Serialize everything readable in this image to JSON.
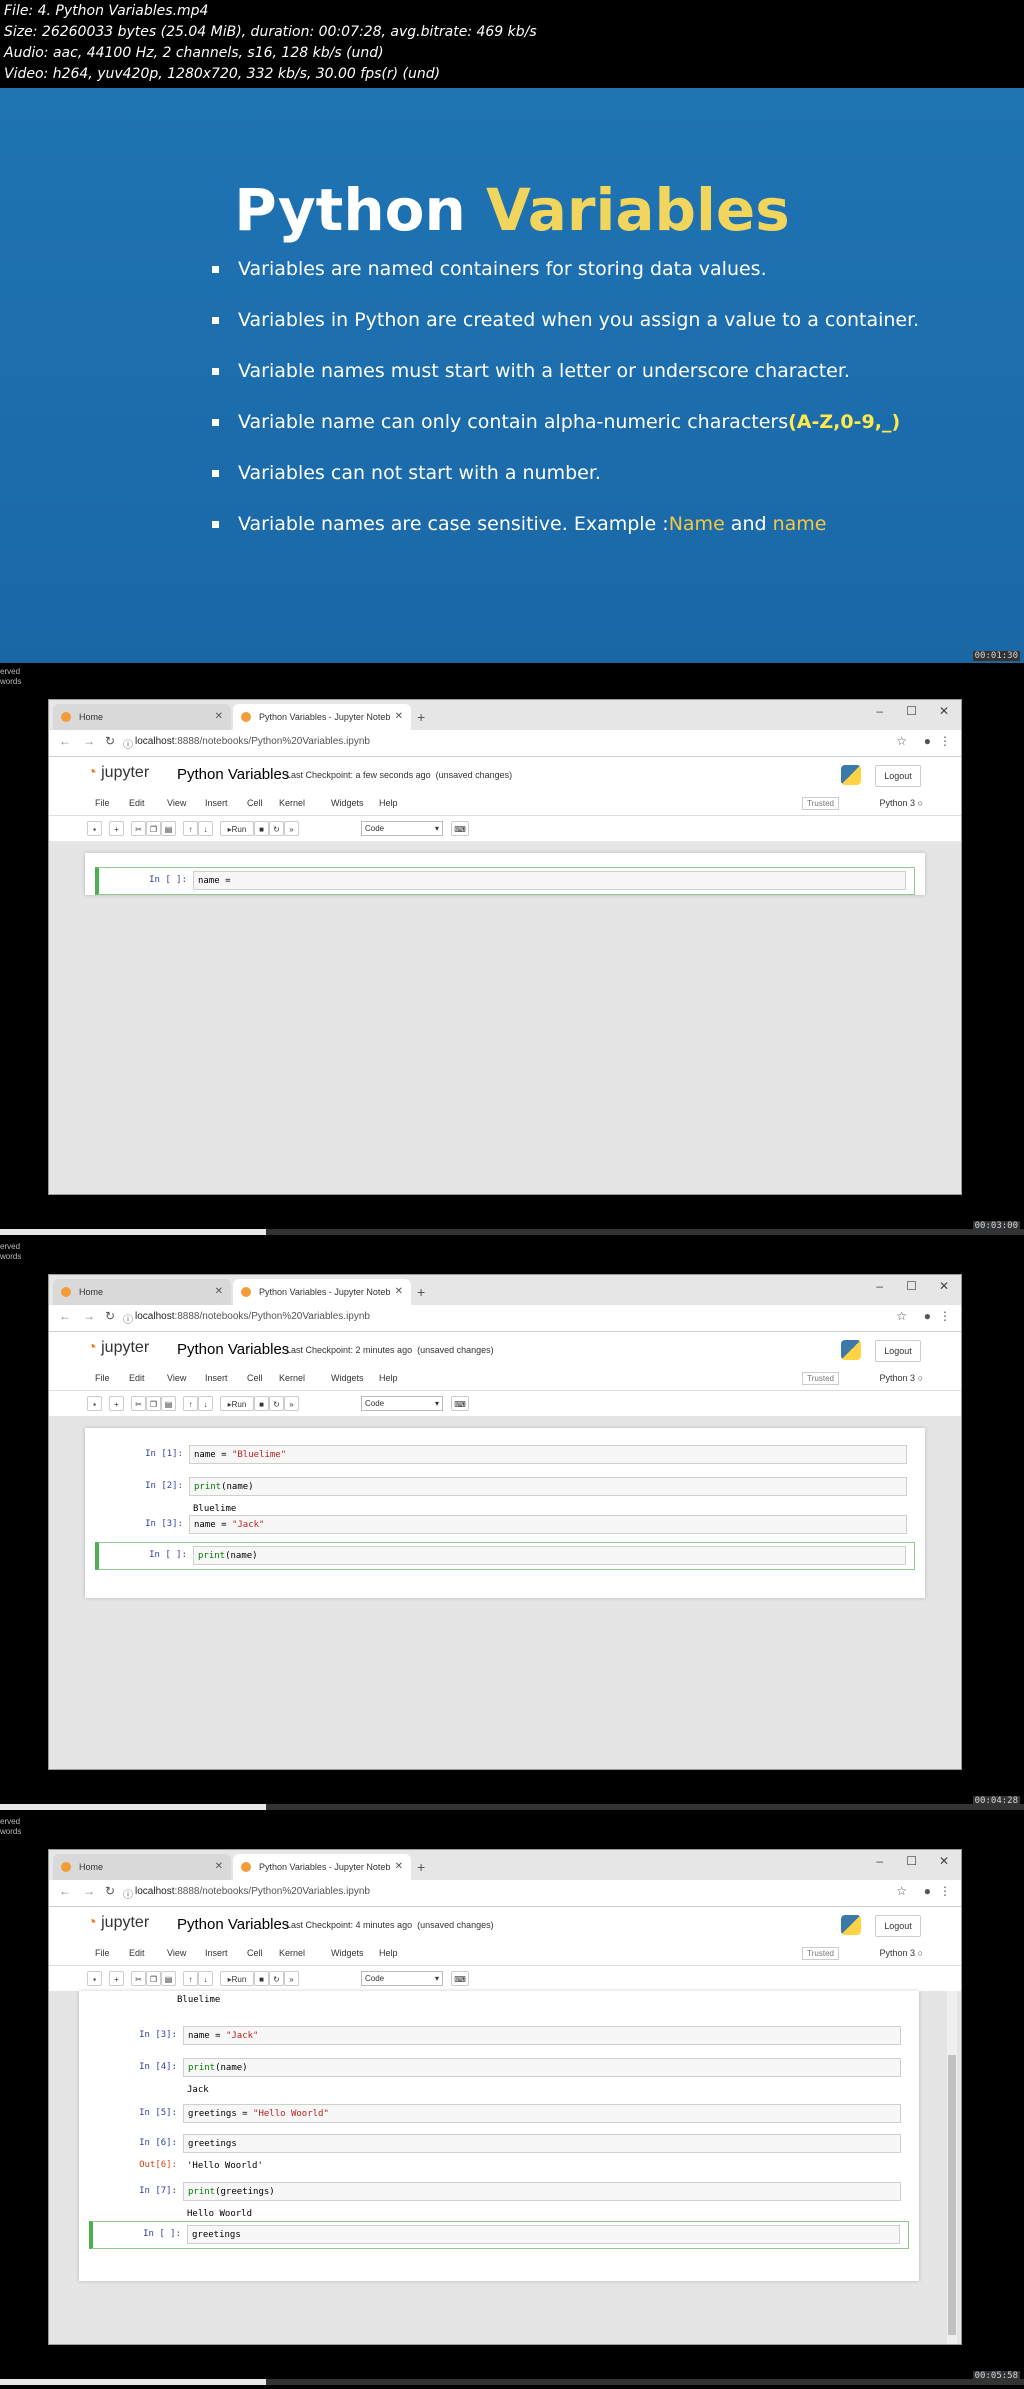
{
  "file_info": {
    "line1": "File: 4. Python Variables.mp4",
    "line2": "Size: 26260033 bytes (25.04 MiB), duration: 00:07:28, avg.bitrate: 469 kb/s",
    "line3": "Audio: aac, 44100 Hz, 2 channels, s16, 128 kb/s (und)",
    "line4": "Video: h264, yuv420p, 1280x720, 332 kb/s, 30.00 fps(r) (und)"
  },
  "slide": {
    "title_part1": "Python",
    "title_part2": "Variables",
    "bullets": [
      "Variables are named containers for storing data values.",
      "Variables in Python are created when you assign a value to a container.",
      "Variable names must start with a letter or underscore character.",
      "Variable name can only contain alpha-numeric characters",
      "Variables can not start with a number.",
      "Variable names are case sensitive.  Example :"
    ],
    "bullet4_highlight": "(A-Z,0-9,_)",
    "bullet6_name1": "Name",
    "bullet6_and": " and ",
    "bullet6_name2": "name",
    "timestamp": "00:01:30",
    "colors": {
      "background": "#1e6fae",
      "accent": "#f1d55c",
      "highlight": "#ffe94b"
    }
  },
  "side_text": {
    "line1": "erved",
    "line2": "words"
  },
  "frames": [
    {
      "timestamp": "00:03:00",
      "checkpoint": "Last Checkpoint: a few seconds ago",
      "status": "(unsaved changes)",
      "progress": 0.26,
      "cells": [
        {
          "prompt": "In [ ]:",
          "code": "name = ",
          "selected": true
        }
      ]
    },
    {
      "timestamp": "00:04:28",
      "checkpoint": "Last Checkpoint: 2 minutes ago",
      "status": "(unsaved changes)",
      "progress": 0.26,
      "cells": [
        {
          "prompt": "In [1]:",
          "code": "name = \"Bluelime\""
        },
        {
          "prompt": "In [2]:",
          "code": "print(name)",
          "output": "Bluelime"
        },
        {
          "prompt": "In [3]:",
          "code": "name = \"Jack\""
        },
        {
          "prompt": "In [ ]:",
          "code": "print(name)",
          "selected": true
        }
      ]
    },
    {
      "timestamp": "00:05:58",
      "checkpoint": "Last Checkpoint: 4 minutes ago",
      "status": "(unsaved changes)",
      "progress": 0.26,
      "top_output": "Bluelime",
      "cells": [
        {
          "prompt": "In [3]:",
          "code": "name = \"Jack\""
        },
        {
          "prompt": "In [4]:",
          "code": "print(name)",
          "output": "Jack"
        },
        {
          "prompt": "In [5]:",
          "code": "greetings = \"Hello Woorld\""
        },
        {
          "prompt": "In [6]:",
          "code": "greetings",
          "out_prompt": "Out[6]:",
          "output": "'Hello Woorld'"
        },
        {
          "prompt": "In [7]:",
          "code": "print(greetings)",
          "output": "Hello Woorld"
        },
        {
          "prompt": "In [ ]:",
          "code": "greetings ",
          "selected": true
        }
      ]
    }
  ],
  "browser": {
    "tab_home": "Home",
    "tab_notebook": "Python Variables - Jupyter Noteb",
    "url_host": "localhost",
    "url_path": ":8888/notebooks/Python%20Variables.ipynb",
    "jupyter_logo": "jupyter",
    "notebook_title": "Python Variables",
    "logout": "Logout",
    "menu": [
      "File",
      "Edit",
      "View",
      "Insert",
      "Cell",
      "Kernel",
      "Widgets",
      "Help"
    ],
    "trusted": "Trusted",
    "kernel": "Python 3",
    "run_label": "Run",
    "cell_type": "Code"
  }
}
